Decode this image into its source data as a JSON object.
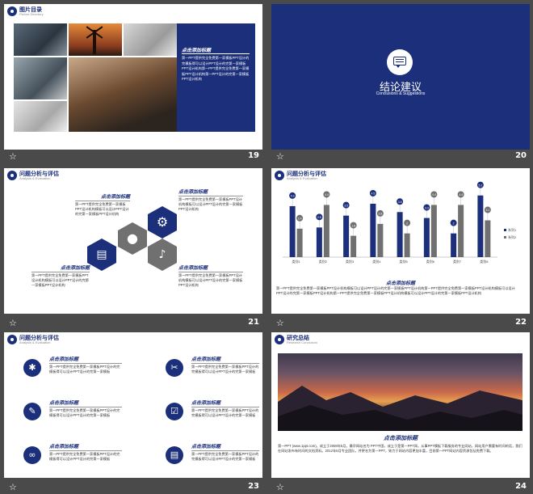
{
  "slides": {
    "s19": {
      "number": "19",
      "header_title": "图片目录",
      "header_sub": "Picture Directory",
      "panel_title": "点击添加标题",
      "panel_text": "第一PPT提供完全免费第一家模板PPT设计的完模板得可以设计PPT设计的完第一家模板PPT设计机构第一PPT提供完全免费第一家模板PPT设计机构第一PPT设计的完第一家模板PPT设计机构"
    },
    "s20": {
      "number": "20",
      "title": "结论建议",
      "subtitle": "Conclusions & Suggestions"
    },
    "s21": {
      "number": "21",
      "header_title": "问题分析与评估",
      "header_sub": "Analysis & Evaluation",
      "block1_title": "点击添加标题",
      "block1_text": "第一PPT提供完全免费第一家模板PPT设计机构模板可以设计PPT设计的完第一家模板PPT设计机构",
      "block2_title": "点击添加标题",
      "block2_text": "第一PPT提供完全免费第一家模板PPT设计机构模板可以设计PPT设计的完第一家模板PPT设计机构",
      "block3_title": "点击添加标题",
      "block3_text": "第一PPT提供完全免费第一家模板PPT设计机构模板可以设计PPT设计的完第一家模板PPT设计机构",
      "block4_title": "点击添加标题",
      "block4_text": "第一PPT提供完全免费第一家模板PPT设计机构模板可以设计PPT设计的完第一家模板PPT设计机构"
    },
    "s22": {
      "number": "22",
      "header_title": "问题分析与评估",
      "header_sub": "Analysis & Evaluation",
      "caption_title": "点击添加标题",
      "caption_text": "第一PPT提供完全免费第一家模板PPT设计机构模板可以设计PPT设计的完第一家模板PPT设计机构第一PPT提供完全免费第一家模板PPT设计机构模板可以设计PPT设计的完第一家模板PPT设计机构第一PPT提供完全免费第一家模板PPT设计机构模板可以设计PPT设计的完第一家模板PPT设计机构"
    },
    "s23": {
      "number": "23",
      "header_title": "问题分析与评估",
      "header_sub": "Analysis & Evaluation",
      "items": [
        {
          "title": "点击添加标题",
          "text": "第一PPT提供完全免费第一家模板PPT设计的完模板得可以设计PPT设计的完第一家模板"
        },
        {
          "title": "点击添加标题",
          "text": "第一PPT提供完全免费第一家模板PPT设计的完模板得可以设计PPT设计的完第一家模板"
        },
        {
          "title": "点击添加标题",
          "text": "第一PPT提供完全免费第一家模板PPT设计的完模板得可以设计PPT设计的完第一家模板"
        },
        {
          "title": "点击添加标题",
          "text": "第一PPT提供完全免费第一家模板PPT设计的完模板得可以设计PPT设计的完第一家模板"
        },
        {
          "title": "点击添加标题",
          "text": "第一PPT提供完全免费第一家模板PPT设计的完模板得可以设计PPT设计的完第一家模板"
        },
        {
          "title": "点击添加标题",
          "text": "第一PPT提供完全免费第一家模板PPT设计的完模板得可以设计PPT设计的完第一家模板"
        }
      ],
      "icons": [
        "lightbulb-icon",
        "tools-icon",
        "pencil-icon",
        "checkbox-icon",
        "link-icon",
        "reader-icon"
      ]
    },
    "s24": {
      "number": "24",
      "header_title": "研究总结",
      "header_sub": "Research Conclusion",
      "caption_title": "点击添加标题",
      "caption_text": "第一PPT (www.1ppt.com)，成立于2008年5月，最早网站名为 PPT中国，成立于是第一PPT网，从事PPT模板下载服务的专业网站，网站用户需要有时间的话，我们在网站发布有时间的文档资料。2012年5月专业团队，并更名为第一PPT，致力于网站内容更加丰富，目前第一PPT网站内容资源包括免费下载。"
    }
  },
  "chart_data": {
    "type": "bar",
    "categories": [
      "类别1",
      "类别2",
      "类别3",
      "类别4",
      "类别5",
      "类别6",
      "类别7",
      "类别8"
    ],
    "series": [
      {
        "name": "系列1",
        "values": [
          4.3,
          2.5,
          3.5,
          4.5,
          3.8,
          3.3,
          2.0,
          5.2
        ],
        "color": "#1b2f7a"
      },
      {
        "name": "系列2",
        "values": [
          2.4,
          4.4,
          1.8,
          2.8,
          2.0,
          4.4,
          4.4,
          3.1
        ],
        "color": "#707070"
      }
    ],
    "ylim": [
      0,
      6
    ],
    "legend": "right",
    "grid": false
  },
  "colors": {
    "navy": "#1b2f7a",
    "gray": "#707070",
    "background": "#4a4a4a"
  }
}
